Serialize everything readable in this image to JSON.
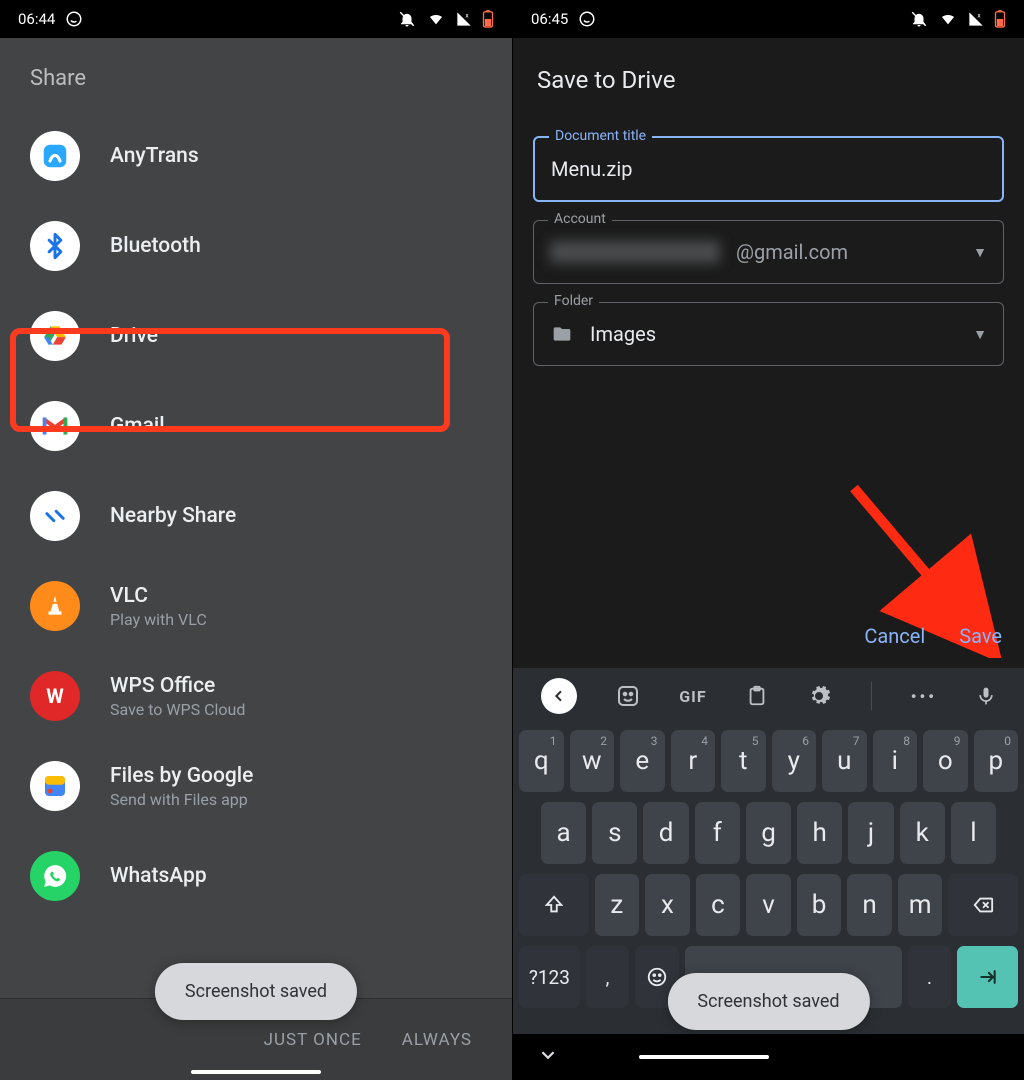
{
  "left": {
    "status": {
      "time": "06:44"
    },
    "title": "Share",
    "items": [
      {
        "label": "AnyTrans",
        "sub": ""
      },
      {
        "label": "Bluetooth",
        "sub": ""
      },
      {
        "label": "Drive",
        "sub": ""
      },
      {
        "label": "Gmail",
        "sub": ""
      },
      {
        "label": "Nearby Share",
        "sub": ""
      },
      {
        "label": "VLC",
        "sub": "Play with VLC"
      },
      {
        "label": "WPS Office",
        "sub": "Save to WPS Cloud"
      },
      {
        "label": "Files by Google",
        "sub": "Send with Files app"
      },
      {
        "label": "WhatsApp",
        "sub": ""
      }
    ],
    "footer": {
      "once": "JUST ONCE",
      "always": "ALWAYS"
    },
    "toast": "Screenshot saved"
  },
  "right": {
    "status": {
      "time": "06:45"
    },
    "title": "Save to Drive",
    "doc": {
      "label": "Document title",
      "value": "Menu.zip"
    },
    "account": {
      "label": "Account",
      "suffix": "@gmail.com"
    },
    "folder": {
      "label": "Folder",
      "value": "Images"
    },
    "buttons": {
      "cancel": "Cancel",
      "save": "Save"
    },
    "toast": "Screenshot saved",
    "keyboard": {
      "row1": [
        "q",
        "w",
        "e",
        "r",
        "t",
        "y",
        "u",
        "i",
        "o",
        "p"
      ],
      "sup1": [
        "1",
        "2",
        "3",
        "4",
        "5",
        "6",
        "7",
        "8",
        "9",
        "0"
      ],
      "row2": [
        "a",
        "s",
        "d",
        "f",
        "g",
        "h",
        "j",
        "k",
        "l"
      ],
      "row3": [
        "z",
        "x",
        "c",
        "v",
        "b",
        "n",
        "m"
      ],
      "sym": "?123",
      "period": ".",
      "comma": ","
    }
  }
}
